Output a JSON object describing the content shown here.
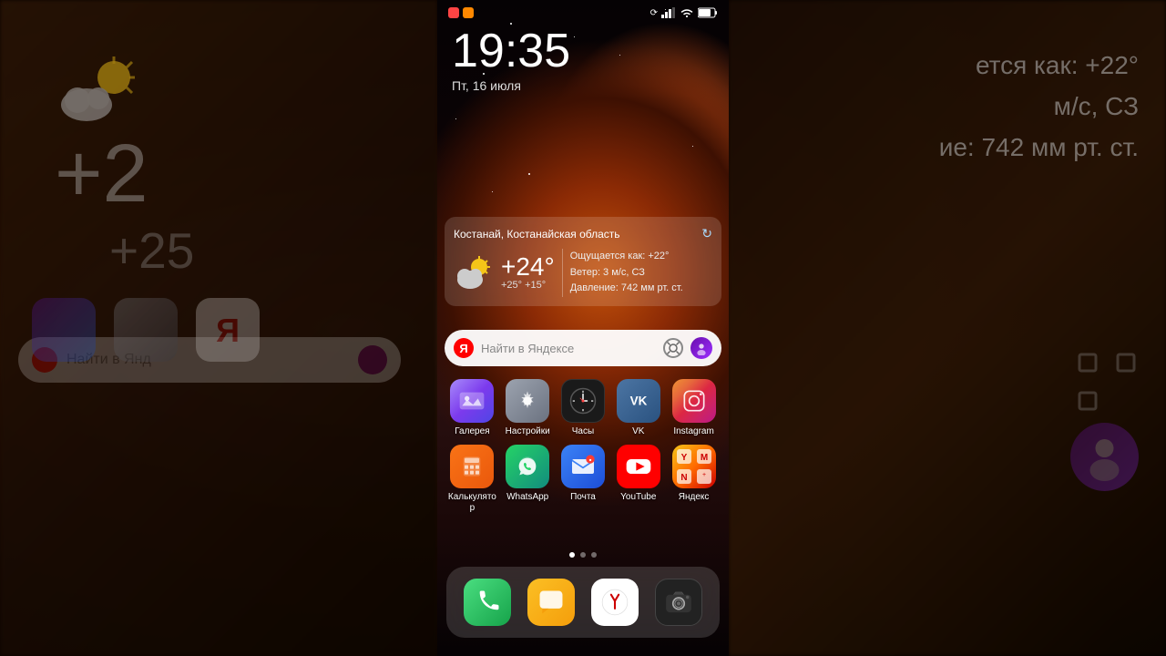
{
  "status_bar": {
    "left_dots": [
      "red",
      "orange"
    ],
    "time": "19:35",
    "date": "Пт, 16 июля",
    "icons": {
      "rotation_lock": "⟳",
      "signal": "▐▐▐",
      "wifi": "wifi",
      "battery": "72%"
    }
  },
  "weather_widget": {
    "location": "Костанай, Костанайская область",
    "temp": "+24°",
    "temp_range": "+25° +15°",
    "feels_like": "Ощущается как: +22°",
    "wind": "Ветер: 3 м/с, СЗ",
    "pressure": "Давление: 742 мм рт. ст.",
    "refresh_icon": "↻"
  },
  "search_bar": {
    "placeholder": "Найти в Яндексе"
  },
  "apps_row1": [
    {
      "id": "gallery",
      "label": "Галерея",
      "icon_type": "gallery"
    },
    {
      "id": "settings",
      "label": "Настройки",
      "icon_type": "settings"
    },
    {
      "id": "clock",
      "label": "Часы",
      "icon_type": "clock"
    },
    {
      "id": "vk",
      "label": "VK",
      "icon_type": "vk"
    },
    {
      "id": "instagram",
      "label": "Instagram",
      "icon_type": "instagram"
    }
  ],
  "apps_row2": [
    {
      "id": "calculator",
      "label": "Калькулятор",
      "icon_type": "calc"
    },
    {
      "id": "whatsapp",
      "label": "WhatsApp",
      "icon_type": "whatsapp"
    },
    {
      "id": "mail",
      "label": "Почта",
      "icon_type": "mail"
    },
    {
      "id": "youtube",
      "label": "YouTube",
      "icon_type": "youtube"
    },
    {
      "id": "yandex",
      "label": "Яндекс",
      "icon_type": "yandex"
    }
  ],
  "page_dots": [
    {
      "active": true
    },
    {
      "active": false
    },
    {
      "active": false
    }
  ],
  "dock": [
    {
      "id": "phone",
      "icon_type": "phone"
    },
    {
      "id": "messenger",
      "icon_type": "messenger"
    },
    {
      "id": "yabrowser",
      "icon_type": "yabrowser"
    },
    {
      "id": "camera",
      "icon_type": "camera-app"
    }
  ],
  "left_panel": {
    "search_text": "Найти в Янд",
    "temp_large": "+2",
    "temp_medium": "+25"
  },
  "right_panel": {
    "line1": "ется как: +22°",
    "line2": "м/с, СЗ",
    "line3": "ие: 742 мм рт. ст."
  }
}
